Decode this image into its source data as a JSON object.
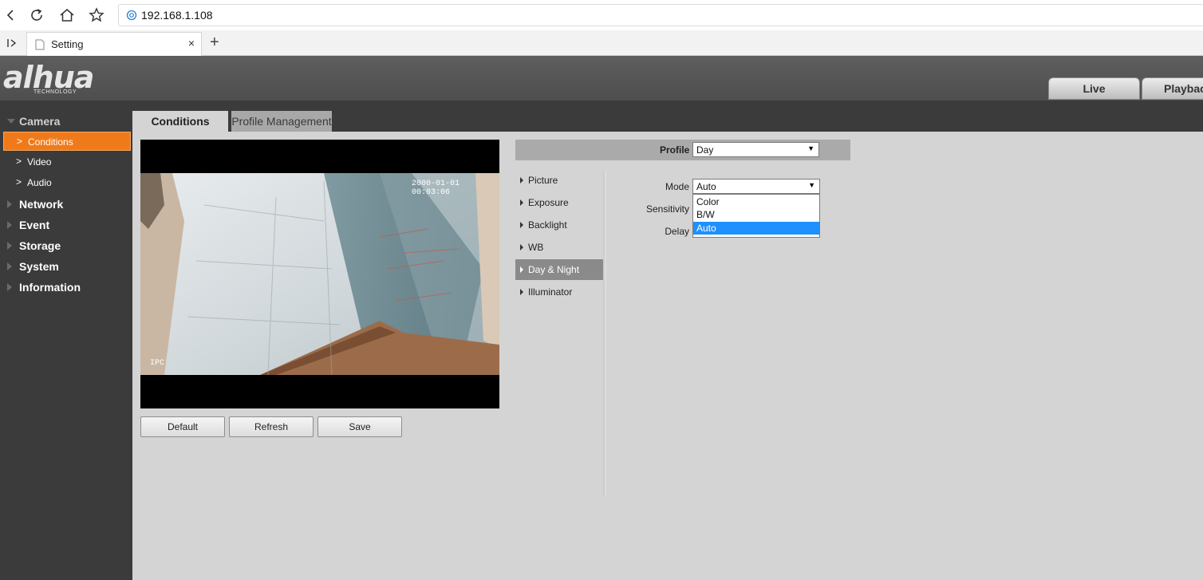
{
  "browser": {
    "url": "192.168.1.108",
    "tab_title": "Setting",
    "tab_close": "×",
    "new_tab": "+"
  },
  "header": {
    "logo_text": "alhua",
    "logo_sub": "TECHNOLOGY",
    "nav": [
      "Live",
      "Playback"
    ]
  },
  "sidebar": {
    "categories": [
      {
        "label": "Camera",
        "expanded": true
      },
      {
        "label": "Network"
      },
      {
        "label": "Event"
      },
      {
        "label": "Storage"
      },
      {
        "label": "System"
      },
      {
        "label": "Information"
      }
    ],
    "camera_items": [
      {
        "label": "Conditions",
        "active": true
      },
      {
        "label": "Video"
      },
      {
        "label": "Audio"
      }
    ]
  },
  "content_tabs": {
    "active": "Conditions",
    "inactive": "Profile Management"
  },
  "video": {
    "timestamp": "2000-01-01 00:03:06",
    "channel": "IPC"
  },
  "buttons": {
    "default": "Default",
    "refresh": "Refresh",
    "save": "Save"
  },
  "profile": {
    "label": "Profile",
    "value": "Day"
  },
  "settings_menu": [
    {
      "label": "Picture"
    },
    {
      "label": "Exposure"
    },
    {
      "label": "Backlight"
    },
    {
      "label": "WB"
    },
    {
      "label": "Day & Night",
      "active": true
    },
    {
      "label": "Illuminator"
    }
  ],
  "fields": {
    "mode_label": "Mode",
    "mode_value": "Auto",
    "sensitivity_label": "Sensitivity",
    "delay_label": "Delay",
    "mode_options": [
      "Color",
      "B/W",
      "Auto"
    ],
    "mode_selected": "Auto"
  },
  "colors": {
    "accent": "#f07a1a",
    "sidebar_bg": "#3b3b3b",
    "content_bg": "#d4d4d4",
    "dropdown_highlight": "#1e90ff"
  }
}
